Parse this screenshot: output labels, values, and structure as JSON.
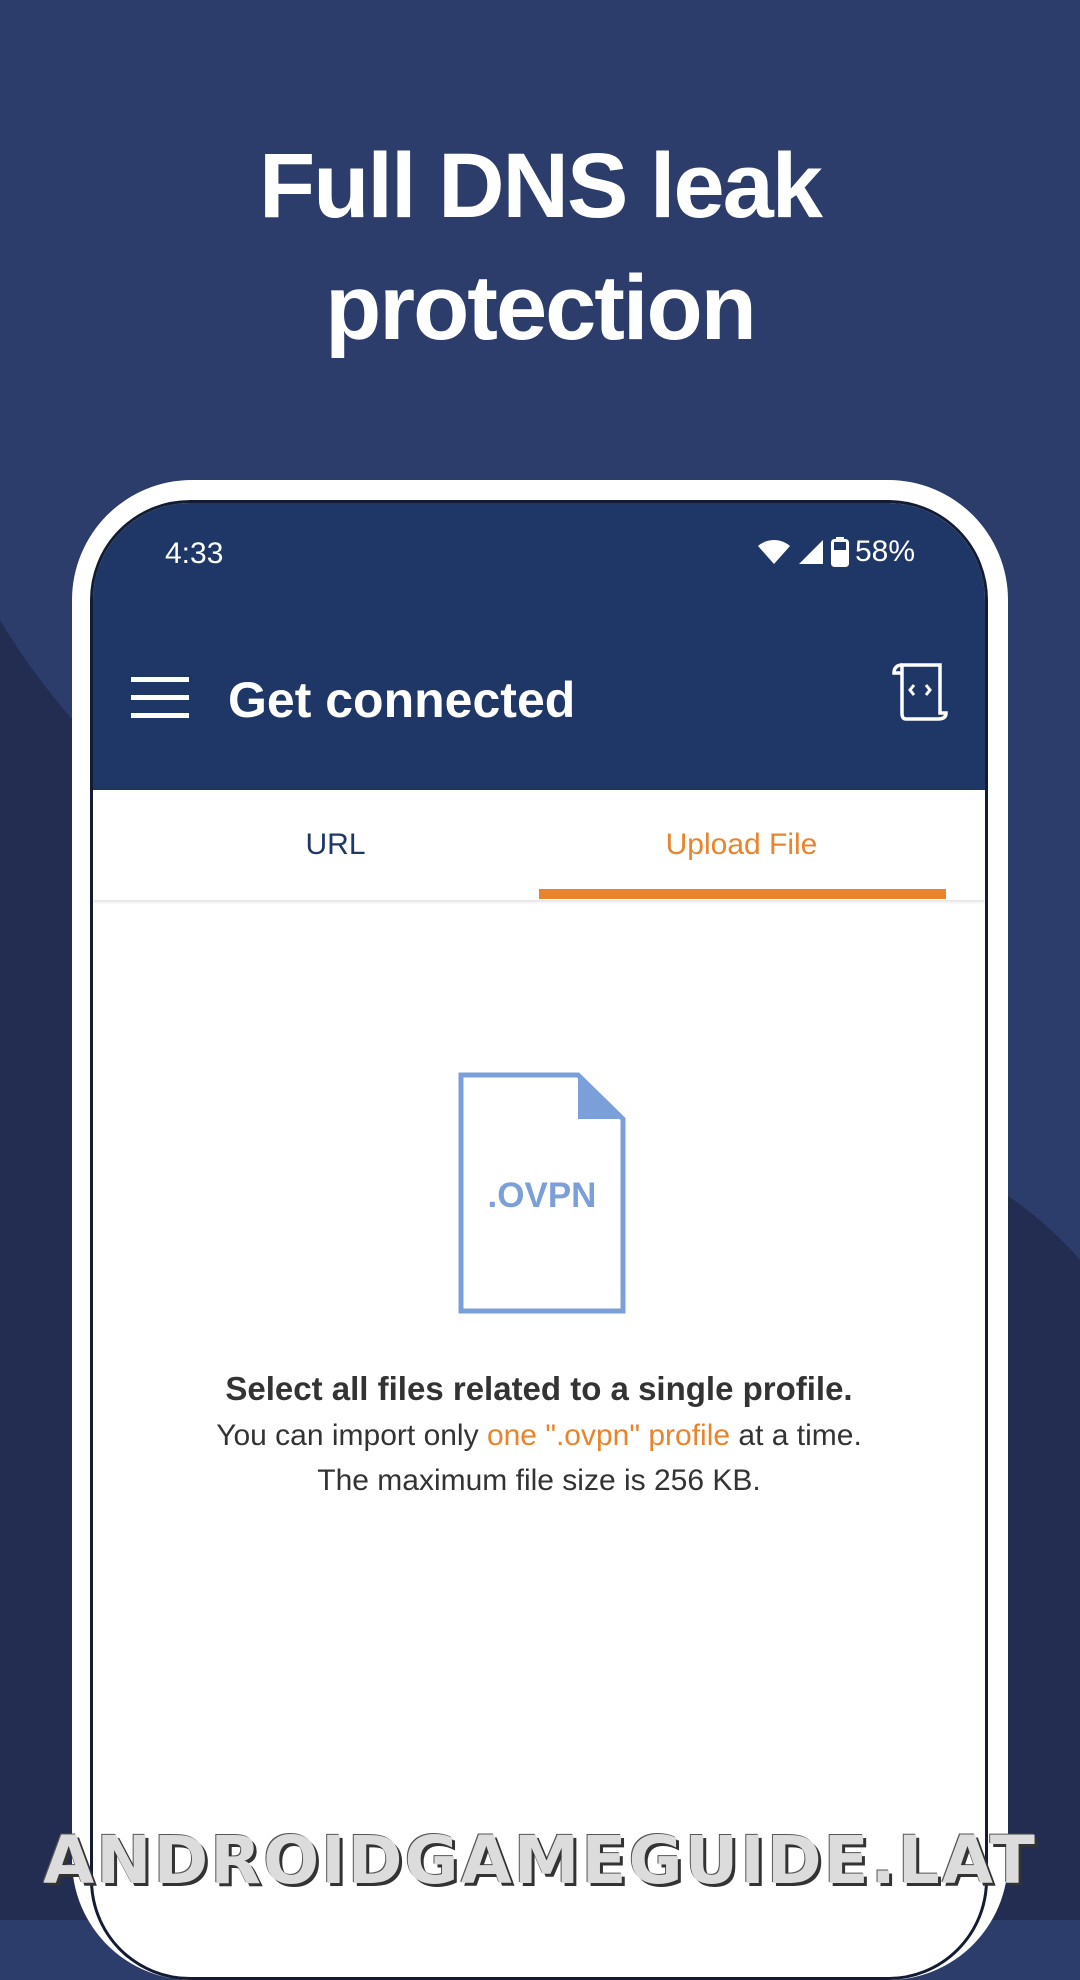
{
  "headline": {
    "line1": "Full DNS leak",
    "line2": "protection"
  },
  "status_bar": {
    "time": "4:33",
    "battery": "58%",
    "icons": [
      "wifi-icon",
      "signal-icon",
      "battery-icon"
    ]
  },
  "toolbar": {
    "title": "Get connected",
    "menu_icon": "hamburger-menu-icon",
    "action_icon": "script-scroll-icon"
  },
  "tabs": [
    {
      "label": "URL",
      "selected": false
    },
    {
      "label": "Upload File",
      "selected": true
    }
  ],
  "upload": {
    "file_label": ".OVPN",
    "heading": "Select all files related to a single profile.",
    "line2_prefix": "You can import only ",
    "line2_highlight": "one \".ovpn\" profile",
    "line2_suffix": " at a time.",
    "line3": "The maximum file size is 256 KB."
  },
  "watermark": "ANDROIDGAMEGUIDE.LAT",
  "colors": {
    "background": "#2d3d6b",
    "appbar": "#1e3766",
    "accent": "#e9842d",
    "file_icon": "#7b9fd9"
  }
}
